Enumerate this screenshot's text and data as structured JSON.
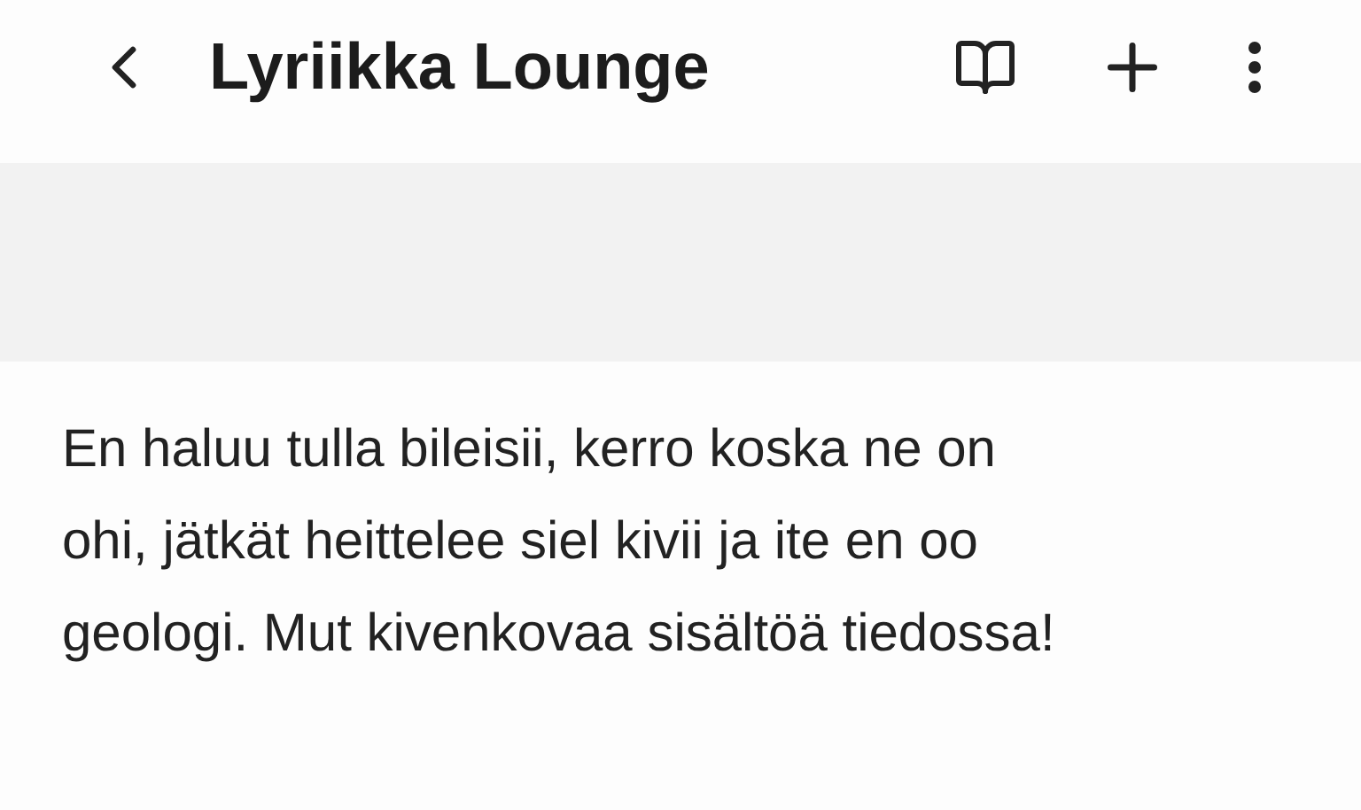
{
  "header": {
    "title": "Lyriikka Lounge"
  },
  "lyrics": {
    "lines": [
      "En haluu tulla bileisii, kerro koska ne on",
      "ohi, jätkät heittelee siel kivii ja ite en oo",
      "geologi. Mut kivenkovaa sisältöä tiedossa!"
    ]
  }
}
